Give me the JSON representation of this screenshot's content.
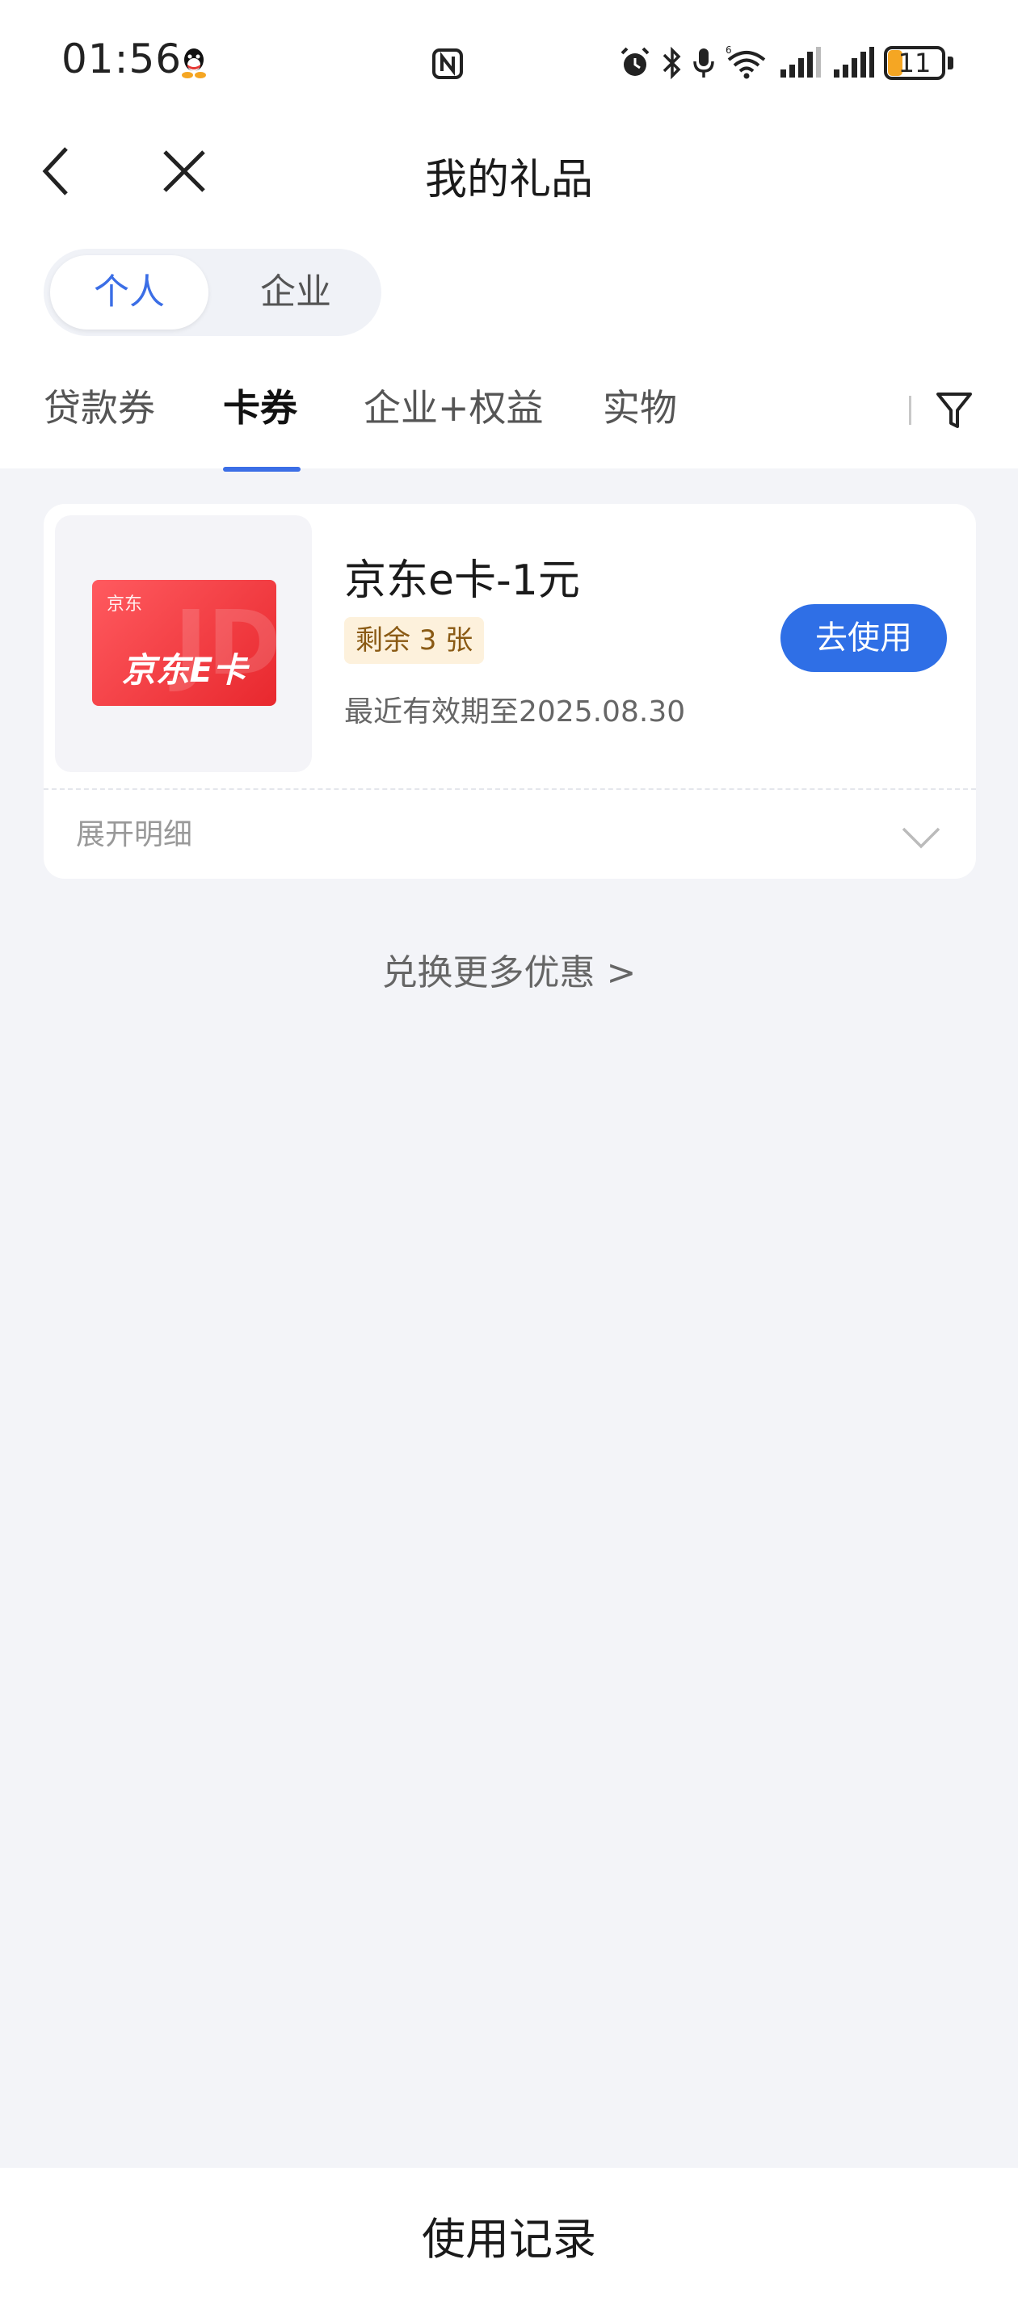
{
  "status_bar": {
    "time": "01:56",
    "battery_level": "11",
    "icons": [
      "qq-icon",
      "nfc-icon",
      "alarm-icon",
      "bluetooth-icon",
      "mic-icon",
      "wifi-icon",
      "signal-icon",
      "signal-icon",
      "battery-icon"
    ]
  },
  "nav": {
    "title": "我的礼品",
    "back_icon": "chevron-left-icon",
    "close_icon": "close-icon"
  },
  "segment": {
    "options": [
      "个人",
      "企业"
    ],
    "selected": "个人"
  },
  "tabs": {
    "items": [
      "贷款券",
      "卡券",
      "企业+权益",
      "实物"
    ],
    "active": "卡券",
    "filter_icon": "filter-icon"
  },
  "gift": {
    "card_brand_small": "京东",
    "card_brand_big": "京东E卡",
    "card_watermark": "JD",
    "name": "京东e卡-1元",
    "remaining": "剩余 3 张",
    "expiry": "最近有效期至2025.08.30",
    "use_button": "去使用",
    "expand_label": "展开明细"
  },
  "more_link": "兑换更多优惠 >",
  "bottom": {
    "label": "使用记录"
  },
  "colors": {
    "accent": "#2f6fe6",
    "badge_bg": "#fdf1dc",
    "badge_text": "#8a5a14",
    "page_bg": "#f3f4f8",
    "card_red": "#e8282e"
  }
}
